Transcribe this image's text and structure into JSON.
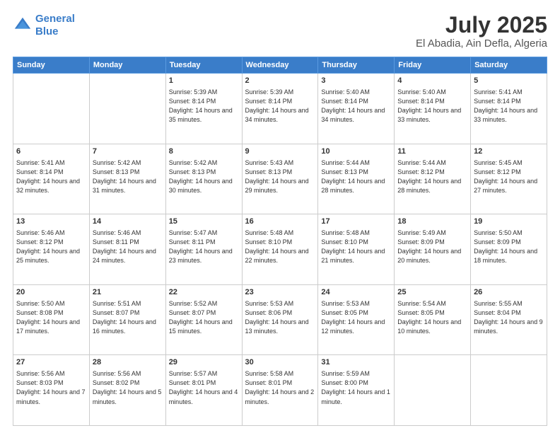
{
  "logo": {
    "line1": "General",
    "line2": "Blue"
  },
  "title": "July 2025",
  "subtitle": "El Abadia, Ain Defla, Algeria",
  "weekdays": [
    "Sunday",
    "Monday",
    "Tuesday",
    "Wednesday",
    "Thursday",
    "Friday",
    "Saturday"
  ],
  "weeks": [
    [
      {
        "day": "",
        "sunrise": "",
        "sunset": "",
        "daylight": ""
      },
      {
        "day": "",
        "sunrise": "",
        "sunset": "",
        "daylight": ""
      },
      {
        "day": "1",
        "sunrise": "Sunrise: 5:39 AM",
        "sunset": "Sunset: 8:14 PM",
        "daylight": "Daylight: 14 hours and 35 minutes."
      },
      {
        "day": "2",
        "sunrise": "Sunrise: 5:39 AM",
        "sunset": "Sunset: 8:14 PM",
        "daylight": "Daylight: 14 hours and 34 minutes."
      },
      {
        "day": "3",
        "sunrise": "Sunrise: 5:40 AM",
        "sunset": "Sunset: 8:14 PM",
        "daylight": "Daylight: 14 hours and 34 minutes."
      },
      {
        "day": "4",
        "sunrise": "Sunrise: 5:40 AM",
        "sunset": "Sunset: 8:14 PM",
        "daylight": "Daylight: 14 hours and 33 minutes."
      },
      {
        "day": "5",
        "sunrise": "Sunrise: 5:41 AM",
        "sunset": "Sunset: 8:14 PM",
        "daylight": "Daylight: 14 hours and 33 minutes."
      }
    ],
    [
      {
        "day": "6",
        "sunrise": "Sunrise: 5:41 AM",
        "sunset": "Sunset: 8:14 PM",
        "daylight": "Daylight: 14 hours and 32 minutes."
      },
      {
        "day": "7",
        "sunrise": "Sunrise: 5:42 AM",
        "sunset": "Sunset: 8:13 PM",
        "daylight": "Daylight: 14 hours and 31 minutes."
      },
      {
        "day": "8",
        "sunrise": "Sunrise: 5:42 AM",
        "sunset": "Sunset: 8:13 PM",
        "daylight": "Daylight: 14 hours and 30 minutes."
      },
      {
        "day": "9",
        "sunrise": "Sunrise: 5:43 AM",
        "sunset": "Sunset: 8:13 PM",
        "daylight": "Daylight: 14 hours and 29 minutes."
      },
      {
        "day": "10",
        "sunrise": "Sunrise: 5:44 AM",
        "sunset": "Sunset: 8:13 PM",
        "daylight": "Daylight: 14 hours and 28 minutes."
      },
      {
        "day": "11",
        "sunrise": "Sunrise: 5:44 AM",
        "sunset": "Sunset: 8:12 PM",
        "daylight": "Daylight: 14 hours and 28 minutes."
      },
      {
        "day": "12",
        "sunrise": "Sunrise: 5:45 AM",
        "sunset": "Sunset: 8:12 PM",
        "daylight": "Daylight: 14 hours and 27 minutes."
      }
    ],
    [
      {
        "day": "13",
        "sunrise": "Sunrise: 5:46 AM",
        "sunset": "Sunset: 8:12 PM",
        "daylight": "Daylight: 14 hours and 25 minutes."
      },
      {
        "day": "14",
        "sunrise": "Sunrise: 5:46 AM",
        "sunset": "Sunset: 8:11 PM",
        "daylight": "Daylight: 14 hours and 24 minutes."
      },
      {
        "day": "15",
        "sunrise": "Sunrise: 5:47 AM",
        "sunset": "Sunset: 8:11 PM",
        "daylight": "Daylight: 14 hours and 23 minutes."
      },
      {
        "day": "16",
        "sunrise": "Sunrise: 5:48 AM",
        "sunset": "Sunset: 8:10 PM",
        "daylight": "Daylight: 14 hours and 22 minutes."
      },
      {
        "day": "17",
        "sunrise": "Sunrise: 5:48 AM",
        "sunset": "Sunset: 8:10 PM",
        "daylight": "Daylight: 14 hours and 21 minutes."
      },
      {
        "day": "18",
        "sunrise": "Sunrise: 5:49 AM",
        "sunset": "Sunset: 8:09 PM",
        "daylight": "Daylight: 14 hours and 20 minutes."
      },
      {
        "day": "19",
        "sunrise": "Sunrise: 5:50 AM",
        "sunset": "Sunset: 8:09 PM",
        "daylight": "Daylight: 14 hours and 18 minutes."
      }
    ],
    [
      {
        "day": "20",
        "sunrise": "Sunrise: 5:50 AM",
        "sunset": "Sunset: 8:08 PM",
        "daylight": "Daylight: 14 hours and 17 minutes."
      },
      {
        "day": "21",
        "sunrise": "Sunrise: 5:51 AM",
        "sunset": "Sunset: 8:07 PM",
        "daylight": "Daylight: 14 hours and 16 minutes."
      },
      {
        "day": "22",
        "sunrise": "Sunrise: 5:52 AM",
        "sunset": "Sunset: 8:07 PM",
        "daylight": "Daylight: 14 hours and 15 minutes."
      },
      {
        "day": "23",
        "sunrise": "Sunrise: 5:53 AM",
        "sunset": "Sunset: 8:06 PM",
        "daylight": "Daylight: 14 hours and 13 minutes."
      },
      {
        "day": "24",
        "sunrise": "Sunrise: 5:53 AM",
        "sunset": "Sunset: 8:05 PM",
        "daylight": "Daylight: 14 hours and 12 minutes."
      },
      {
        "day": "25",
        "sunrise": "Sunrise: 5:54 AM",
        "sunset": "Sunset: 8:05 PM",
        "daylight": "Daylight: 14 hours and 10 minutes."
      },
      {
        "day": "26",
        "sunrise": "Sunrise: 5:55 AM",
        "sunset": "Sunset: 8:04 PM",
        "daylight": "Daylight: 14 hours and 9 minutes."
      }
    ],
    [
      {
        "day": "27",
        "sunrise": "Sunrise: 5:56 AM",
        "sunset": "Sunset: 8:03 PM",
        "daylight": "Daylight: 14 hours and 7 minutes."
      },
      {
        "day": "28",
        "sunrise": "Sunrise: 5:56 AM",
        "sunset": "Sunset: 8:02 PM",
        "daylight": "Daylight: 14 hours and 5 minutes."
      },
      {
        "day": "29",
        "sunrise": "Sunrise: 5:57 AM",
        "sunset": "Sunset: 8:01 PM",
        "daylight": "Daylight: 14 hours and 4 minutes."
      },
      {
        "day": "30",
        "sunrise": "Sunrise: 5:58 AM",
        "sunset": "Sunset: 8:01 PM",
        "daylight": "Daylight: 14 hours and 2 minutes."
      },
      {
        "day": "31",
        "sunrise": "Sunrise: 5:59 AM",
        "sunset": "Sunset: 8:00 PM",
        "daylight": "Daylight: 14 hours and 1 minute."
      },
      {
        "day": "",
        "sunrise": "",
        "sunset": "",
        "daylight": ""
      },
      {
        "day": "",
        "sunrise": "",
        "sunset": "",
        "daylight": ""
      }
    ]
  ]
}
